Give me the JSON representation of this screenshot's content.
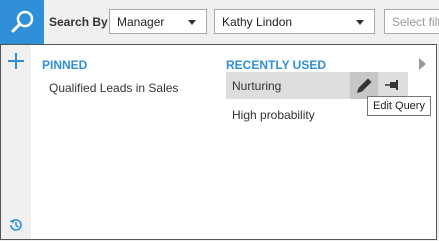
{
  "toolbar": {
    "search_by_label": "Search By",
    "field_dropdown": {
      "selected": "Manager"
    },
    "value_dropdown": {
      "selected": "Kathy Lindon"
    },
    "filter_placeholder": "Select filt"
  },
  "popup": {
    "pinned": {
      "heading": "PINNED",
      "items": [
        "Qualified Leads in Sales"
      ]
    },
    "recent": {
      "heading": "RECENTLY USED",
      "items": [
        "Nurturing",
        "High probability"
      ]
    },
    "tooltip": "Edit Query"
  },
  "colors": {
    "accent": "#2f8fd8",
    "hover_row": "#dedede",
    "hover_button": "#c6c6c6"
  },
  "icons": {
    "search": "search-icon",
    "add": "plus-icon",
    "history": "history-icon",
    "edit": "pencil-icon",
    "pin": "pin-icon"
  }
}
